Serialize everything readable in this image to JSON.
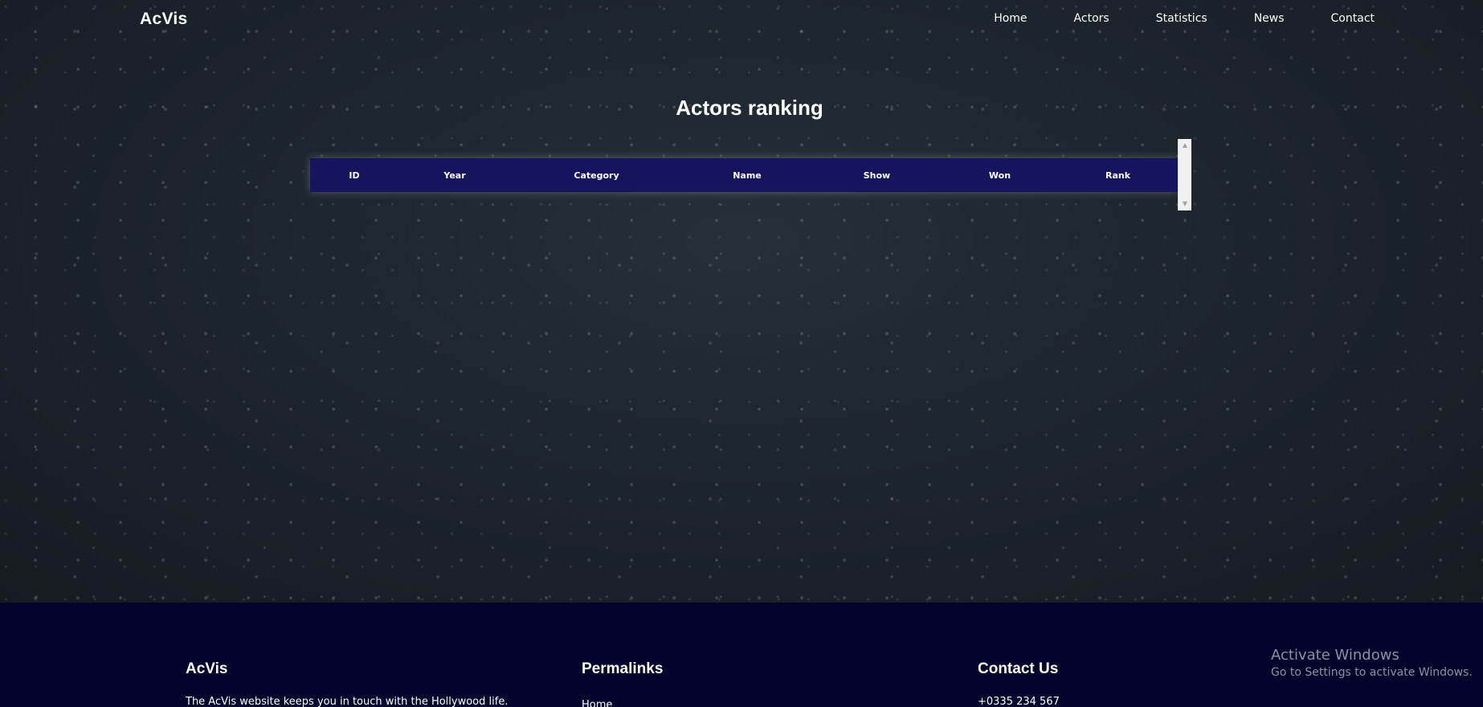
{
  "brand": {
    "name": "AcVis"
  },
  "nav": {
    "items": [
      {
        "label": "Home"
      },
      {
        "label": "Actors"
      },
      {
        "label": "Statistics"
      },
      {
        "label": "News"
      },
      {
        "label": "Contact"
      }
    ]
  },
  "main": {
    "title": "Actors ranking",
    "table": {
      "columns": [
        "ID",
        "Year",
        "Category",
        "Name",
        "Show",
        "Won",
        "Rank"
      ],
      "rows": []
    }
  },
  "footer": {
    "about": {
      "heading": "AcVis",
      "text": "The AcVis website keeps you in touch with the Hollywood life."
    },
    "permalinks": {
      "heading": "Permalinks",
      "first_link": "Home"
    },
    "contact": {
      "heading": "Contact Us",
      "phone": "+0335 234 567"
    }
  },
  "watermark": {
    "title": "Activate Windows",
    "subtitle": "Go to Settings to activate Windows."
  },
  "icons": {
    "scroll_up": "scroll-up-arrow-icon",
    "scroll_down": "scroll-down-arrow-icon"
  },
  "colors": {
    "table_header": "#15145f",
    "footer_bg": "#03032b"
  }
}
